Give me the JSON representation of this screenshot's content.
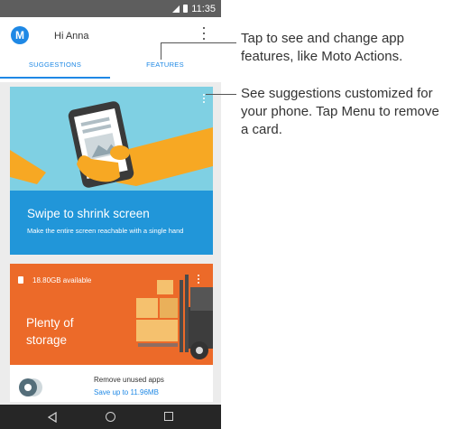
{
  "status_bar": {
    "time": "11:35"
  },
  "header": {
    "logo_glyph": "M",
    "greeting": "Hi Anna"
  },
  "tabs": [
    {
      "label": "SUGGESTIONS",
      "selected": true
    },
    {
      "label": "FEATURES",
      "selected": false
    }
  ],
  "card_swipe": {
    "title": "Swipe to shrink screen",
    "subtitle": "Make the entire screen reachable with a single hand"
  },
  "card_storage": {
    "available": "18.80GB available",
    "title": "Plenty of storage",
    "action_title": "Remove unused apps",
    "action_link": "Save up to 11.96MB"
  },
  "callouts": {
    "features": "Tap to see and change app features, like Moto Actions.",
    "menu": "See suggestions customized for your phone. Tap Menu to remove a card."
  },
  "colors": {
    "accent": "#1e88e5",
    "swipe_card": "#2196d9",
    "swipe_card_art": "#7fd0e3",
    "storage_card": "#ec6a29"
  }
}
